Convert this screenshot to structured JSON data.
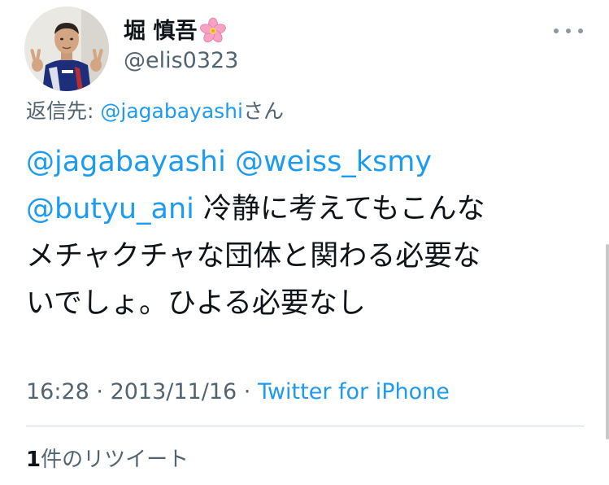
{
  "tweet": {
    "author": {
      "display_name": "堀 慎吾",
      "name_emoji_icon": "cherry-blossom-icon",
      "handle": "@elis0323",
      "avatar_icon": "avatar-photo-person-peace-sign"
    },
    "more_icon": "more-dots-icon",
    "reply_to": {
      "label": "返信先: ",
      "target": "@jagabayashi",
      "suffix": "さん"
    },
    "body": {
      "line1_mention_a": "@jagabayashi",
      "line1_mention_b": "@weiss_ksmy",
      "line2_mention": "@butyu_ani",
      "line2_text": " 冷静に考えてもこんな",
      "line3_text": "メチャクチャな団体と関わる必要な",
      "line4_text": "いでしょ。ひよる必要なし"
    },
    "meta": {
      "time": "16:28",
      "separator": " · ",
      "date": "2013/11/16",
      "source": "Twitter for iPhone"
    },
    "retweets": {
      "count": "1",
      "label": "件のリツイート"
    }
  },
  "colors": {
    "text": "#0f1419",
    "secondary": "#536471",
    "link": "#1d9bf0",
    "divider": "#cfd9de"
  }
}
